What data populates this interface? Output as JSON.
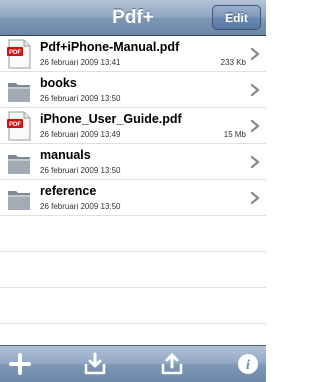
{
  "navbar": {
    "title": "Pdf+",
    "edit_label": "Edit"
  },
  "files": [
    {
      "type": "pdf",
      "name": "Pdf+iPhone-Manual.pdf",
      "date": "26 februari 2009 13:41",
      "size": "233 Kb"
    },
    {
      "type": "folder",
      "name": "books",
      "date": "26 februari 2009 13:50",
      "size": ""
    },
    {
      "type": "pdf",
      "name": "iPhone_User_Guide.pdf",
      "date": "26 februari 2009 13:49",
      "size": "15 Mb"
    },
    {
      "type": "folder",
      "name": "manuals",
      "date": "26 februari 2009 13:50",
      "size": ""
    },
    {
      "type": "folder",
      "name": "reference",
      "date": "26 februari 2009 13:50",
      "size": ""
    }
  ],
  "toolbar": {
    "add_icon": "plus-icon",
    "import_icon": "tray-download-icon",
    "export_icon": "tray-upload-icon",
    "info_icon": "info-icon"
  },
  "colors": {
    "pdf_badge": "#d01010",
    "folder": "#9aa3ad"
  }
}
